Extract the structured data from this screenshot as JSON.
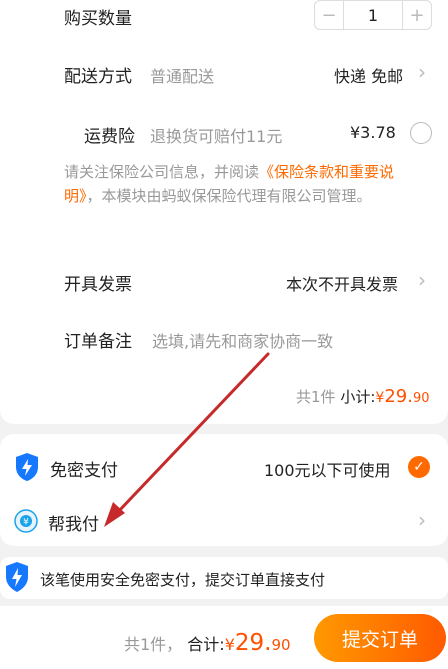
{
  "order": {
    "quantity_label": "购买数量",
    "quantity_value": "1",
    "minus": "−",
    "plus": "+",
    "delivery_label": "配送方式",
    "delivery_method": "普通配送",
    "delivery_value": "快递 免邮",
    "insurance_label": "运费险",
    "insurance_desc": "退换货可赔付11元",
    "insurance_price": "¥3.78",
    "notice_pre": "请关注保险公司信息，并阅读",
    "notice_link": "《保险条款和重要说明》",
    "notice_post": "，本模块由蚂蚁保保险代理有限公司管理。",
    "invoice_label": "开具发票",
    "invoice_value": "本次不开具发票",
    "remark_label": "订单备注",
    "remark_placeholder": "选填,请先和商家协商一致",
    "subtotal_count": "共1件",
    "subtotal_label": "小计:",
    "subtotal_currency": "¥",
    "subtotal_int": "29.",
    "subtotal_dec": "90"
  },
  "payment": {
    "nopwd_label": "免密支付",
    "nopwd_limit": "100元以下可使用",
    "helper_label": "帮我付",
    "tip": "该笔使用安全免密支付，提交订单直接支付"
  },
  "footer": {
    "count": "共1件，",
    "total_label": "合计:",
    "currency": "¥",
    "int": "29.",
    "dec": "90",
    "submit": "提交订单"
  },
  "colors": {
    "accent": "#ff6a00",
    "shield": "#1677ff",
    "annotation_arrow": "#c62a2a"
  }
}
